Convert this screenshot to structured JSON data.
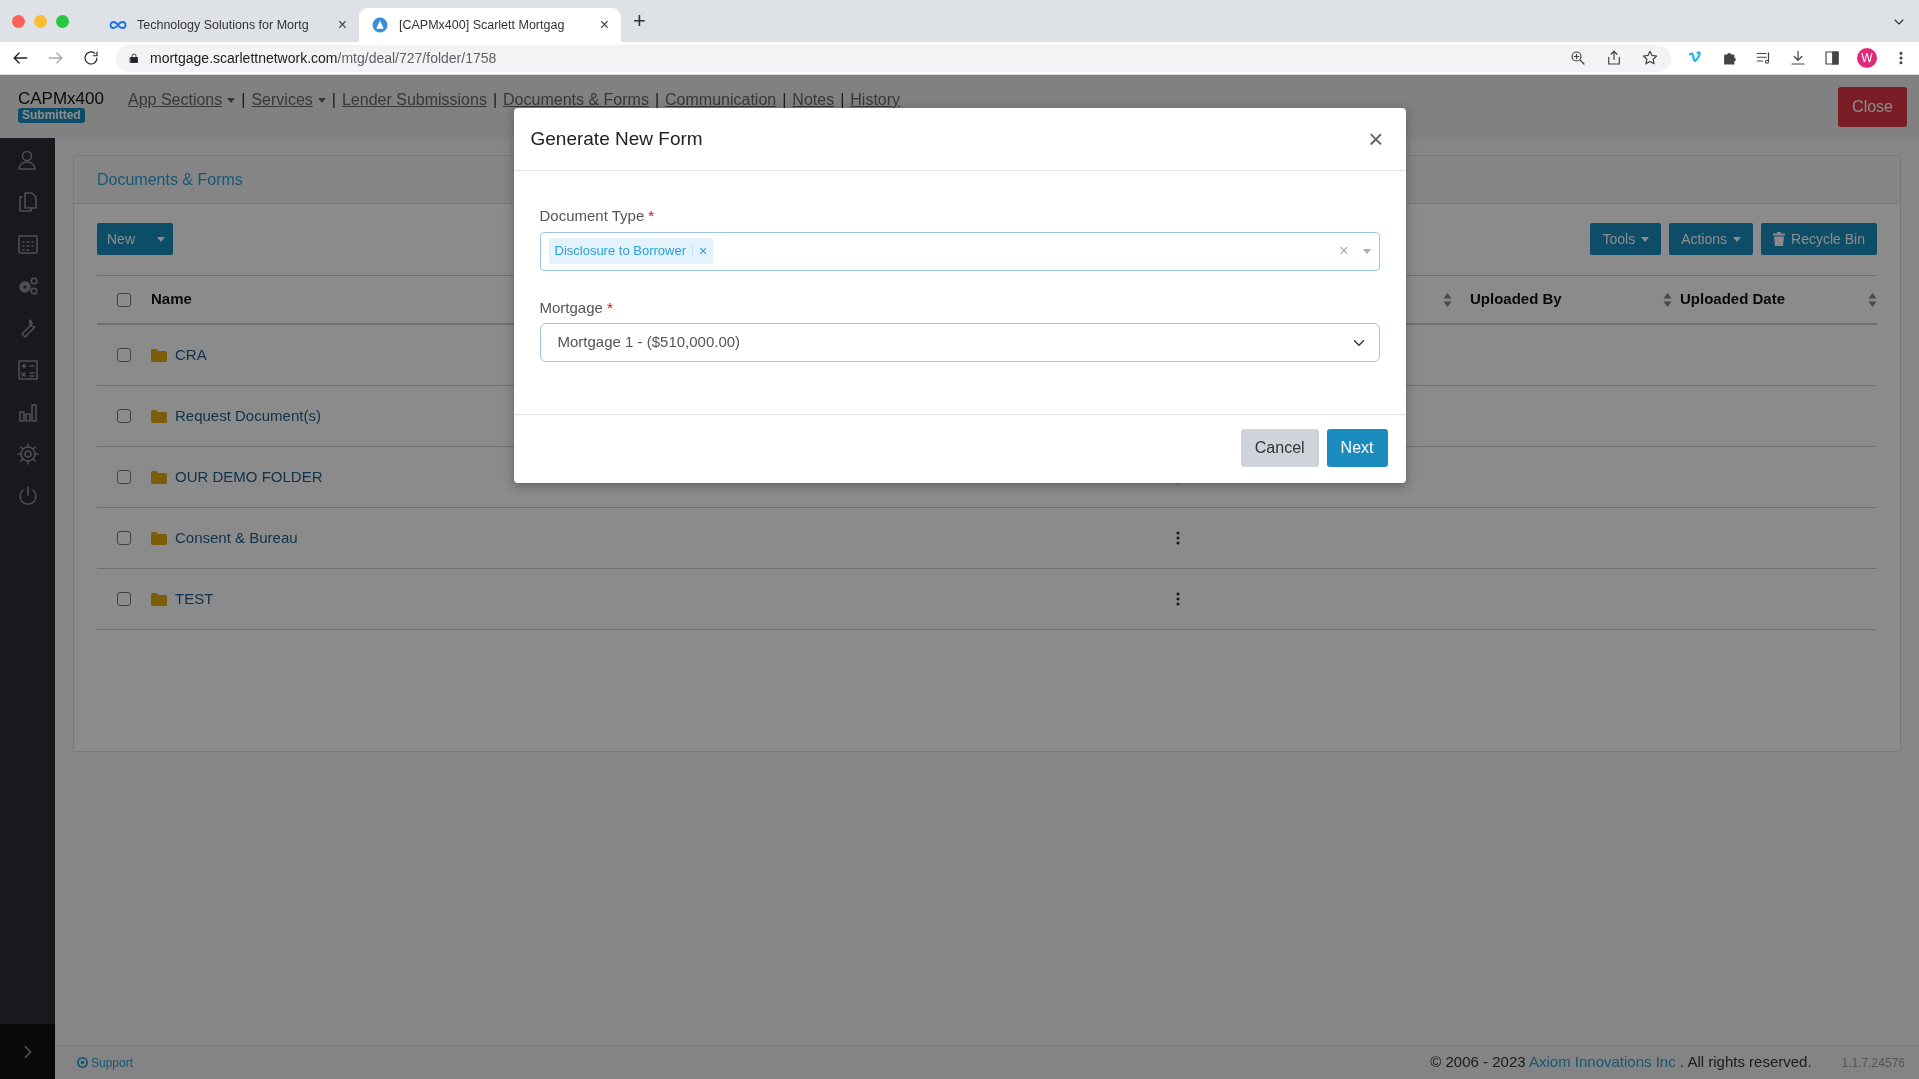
{
  "browser": {
    "tabs": [
      {
        "title": "Technology Solutions for Mortg",
        "selected": false
      },
      {
        "title": "[CAPMx400] Scarlett Mortgag",
        "selected": true
      }
    ],
    "close_glyph": "×",
    "new_tab_glyph": "+",
    "url": {
      "domain": "mortgage.scarlettnetwork.com",
      "path": "/mtg/deal/727/folder/1758"
    },
    "profile_initial": "W"
  },
  "header": {
    "brand": "CAPMx400",
    "status_badge": "Submitted",
    "nav": [
      {
        "kind": "dropdown",
        "label": "App Sections"
      },
      {
        "kind": "separator",
        "label": "|"
      },
      {
        "kind": "dropdown",
        "label": "Services"
      },
      {
        "kind": "separator",
        "label": "|"
      },
      {
        "kind": "link",
        "label": "Lender Submissions"
      },
      {
        "kind": "separator",
        "label": "|"
      },
      {
        "kind": "link",
        "label": "Documents & Forms"
      },
      {
        "kind": "separator",
        "label": "|"
      },
      {
        "kind": "link",
        "label": "Communication"
      },
      {
        "kind": "separator",
        "label": "|"
      },
      {
        "kind": "link",
        "label": "Notes"
      },
      {
        "kind": "separator",
        "label": "|"
      },
      {
        "kind": "link",
        "label": "History"
      }
    ],
    "close_button": "Close"
  },
  "page": {
    "breadcrumb": "Documents & Forms",
    "new_button": "New",
    "toolbar": [
      {
        "kind": "dropdown",
        "label": "Tools"
      },
      {
        "kind": "dropdown",
        "label": "Actions"
      },
      {
        "kind": "trash",
        "label": "Recycle Bin"
      }
    ],
    "table": {
      "select_all_checked": false,
      "columns": [
        {
          "label": "Name",
          "sortable": false
        },
        {
          "sortable": true
        },
        {
          "label": "Uploaded By",
          "sortable": true
        },
        {
          "label": "Uploaded Date",
          "sortable": true
        }
      ],
      "rows": [
        {
          "name": "CRA",
          "checked": false,
          "menu": false
        },
        {
          "name": "Request Document(s)",
          "checked": false,
          "menu": false
        },
        {
          "name": "OUR DEMO FOLDER",
          "checked": false,
          "menu": true
        },
        {
          "name": "Consent & Bureau",
          "checked": false,
          "menu": true
        },
        {
          "name": "TEST",
          "checked": false,
          "menu": true
        }
      ]
    }
  },
  "footer": {
    "support": "Support",
    "copyright": "© 2006 - 2023",
    "company": "Axiom Innovations Inc",
    "rights": ". All rights reserved.",
    "version": "1.1.7.24576"
  },
  "modal": {
    "title": "Generate New Form",
    "close_glyph": "×",
    "fields": [
      {
        "kind": "tags",
        "label": "Document Type",
        "required_mark": "*",
        "tags": [
          "Disclosure to Borrower"
        ],
        "tag_remove": "×",
        "clear_glyph": "×"
      },
      {
        "kind": "select",
        "label": "Mortgage",
        "required_mark": "*",
        "value": "Mortgage 1 - ($510,000.00)"
      }
    ],
    "buttons": [
      {
        "kind": "secondary",
        "label": "Cancel"
      },
      {
        "kind": "primary",
        "label": "Next"
      }
    ]
  }
}
